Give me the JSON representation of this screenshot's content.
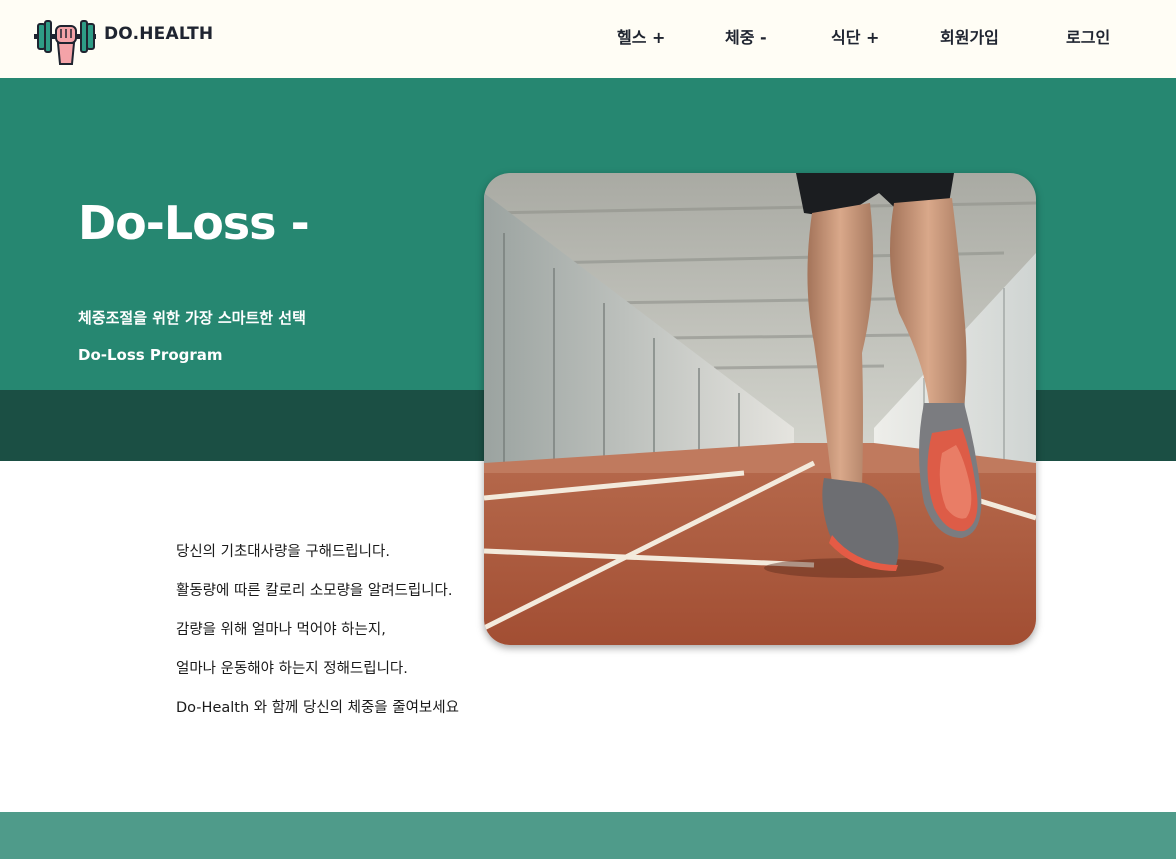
{
  "brand": {
    "name": "DO.HEALTH"
  },
  "nav": {
    "items": [
      {
        "label": "헬스 +"
      },
      {
        "label": "체중 -"
      },
      {
        "label": "식단 +"
      },
      {
        "label": "회원가입"
      },
      {
        "label": "로그인"
      }
    ]
  },
  "hero": {
    "title": "Do-Loss -",
    "subtitle": "체중조절을 위한 가장 스마트한 선택",
    "program": "Do-Loss Program"
  },
  "description": {
    "lines": [
      "당신의 기초대사량을 구해드립니다.",
      "활동량에 따른 칼로리 소모량을 알려드립니다.",
      "감량을 위해 얼마나 먹어야 하는지,",
      "얼마나 운동해야 하는지 정해드립니다.",
      "Do-Health 와 함께 당신의 체중을 줄여보세요"
    ]
  },
  "colors": {
    "header_bg": "#fffdf5",
    "hero_bg": "#268771",
    "hero_band": "#1b4f44",
    "footer_bg": "#4f9b8a",
    "text_dark": "#1f2430"
  },
  "icons": {
    "logo": "dumbbell-fist-icon",
    "hero_image": "runner-on-track-photo"
  }
}
